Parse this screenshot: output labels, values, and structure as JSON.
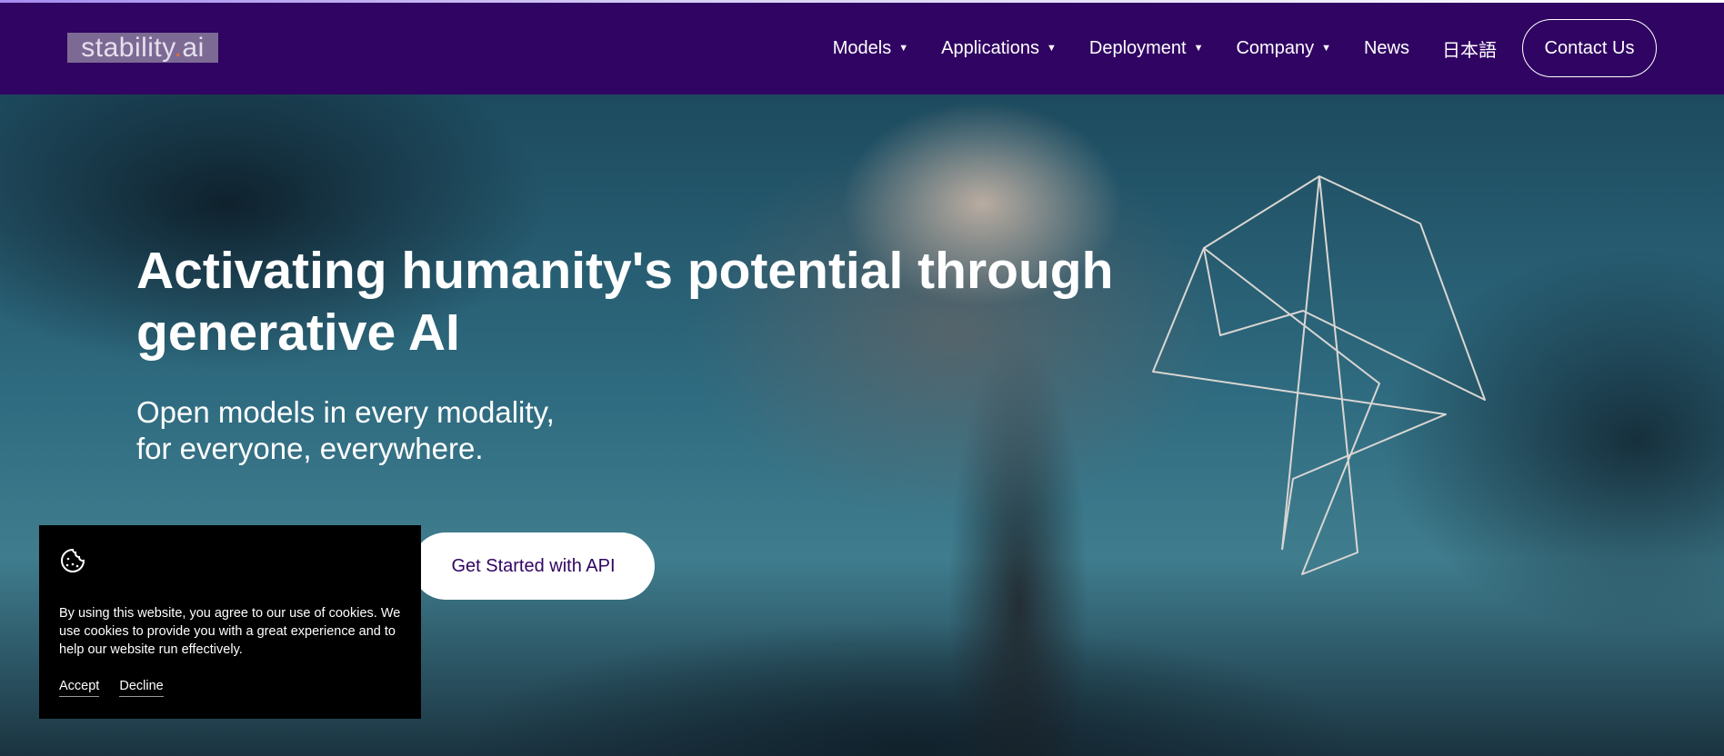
{
  "header": {
    "logo": {
      "text": "stability",
      "dot": ".",
      "suffix": "ai"
    },
    "nav": [
      {
        "label": "Models",
        "dropdown": true
      },
      {
        "label": "Applications",
        "dropdown": true
      },
      {
        "label": "Deployment",
        "dropdown": true
      },
      {
        "label": "Company",
        "dropdown": true
      },
      {
        "label": "News",
        "dropdown": false
      },
      {
        "label": "日本語",
        "dropdown": false
      }
    ],
    "caret": "▼",
    "contact_label": "Contact Us"
  },
  "hero": {
    "headline": "Activating humanity's potential through generative AI",
    "subtitle_line1": "Open models in every modality,",
    "subtitle_line2": "for everyone, everywhere.",
    "api_button": "Get Started with API"
  },
  "cookie_banner": {
    "icon": "cookie-icon",
    "text": "By using this website, you agree to our use of cookies. We use cookies to provide you with a great experience and to help our website run effectively.",
    "accept": "Accept",
    "decline": "Decline"
  },
  "colors": {
    "nav_bg": "#300462",
    "button_text": "#300462",
    "banner_bg": "#000000"
  }
}
